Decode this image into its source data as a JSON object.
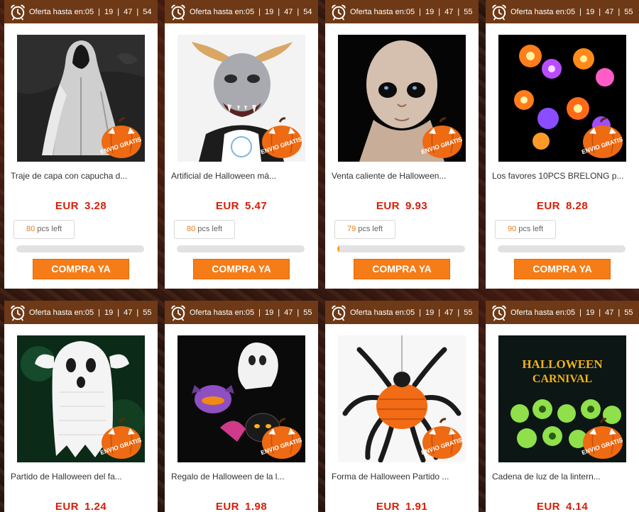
{
  "timer_label": "Oferta hasta en:",
  "buy_label": "COMPRA YA",
  "stock_suffix": "pcs left",
  "badge_text": "ENVIO GRATIS",
  "currency": "EUR",
  "colors": {
    "header": "#6e3916",
    "price": "#d81e06",
    "button": "#f57c17",
    "stock_num": "#e8791c",
    "badge": "#ee6a13"
  },
  "products": [
    {
      "timer": [
        "05",
        "19",
        "47",
        "54"
      ],
      "title": "Traje de capa con capucha d...",
      "price": "3.28",
      "stock": "80",
      "sold_fraction": 0.0,
      "image": "white-hooded-cape"
    },
    {
      "timer": [
        "05",
        "19",
        "47",
        "54"
      ],
      "title": "Artificial de Halloween má...",
      "price": "5.47",
      "stock": "80",
      "sold_fraction": 0.0,
      "image": "horned-demon-mask"
    },
    {
      "timer": [
        "05",
        "19",
        "47",
        "55"
      ],
      "title": "Venta caliente de Halloween...",
      "price": "9.93",
      "stock": "79",
      "sold_fraction": 0.0125,
      "image": "alien-latex-mask"
    },
    {
      "timer": [
        "05",
        "19",
        "47",
        "55"
      ],
      "title": "Los favores 10PCS BRELONG p...",
      "price": "8.28",
      "stock": "90",
      "sold_fraction": 0.0,
      "image": "led-pumpkin-rings"
    },
    {
      "timer": [
        "05",
        "19",
        "47",
        "55"
      ],
      "title": "Partido de Halloween del fa...",
      "price": "1.24",
      "image": "hanging-ghost"
    },
    {
      "timer": [
        "05",
        "19",
        "47",
        "55"
      ],
      "title": "Regalo de Halloween de la l...",
      "price": "1.98",
      "image": "paper-lanterns"
    },
    {
      "timer": [
        "05",
        "19",
        "47",
        "55"
      ],
      "title": "Forma de Halloween Partido ...",
      "price": "1.91",
      "image": "honeycomb-spider"
    },
    {
      "timer": [
        "05",
        "19",
        "47",
        "55"
      ],
      "title": "Cadena de luz de la lintern...",
      "price": "4.14",
      "image": "halloween-carnival-lights",
      "image_text": [
        "HALLOWEEN",
        "CARNIVAL"
      ]
    }
  ]
}
